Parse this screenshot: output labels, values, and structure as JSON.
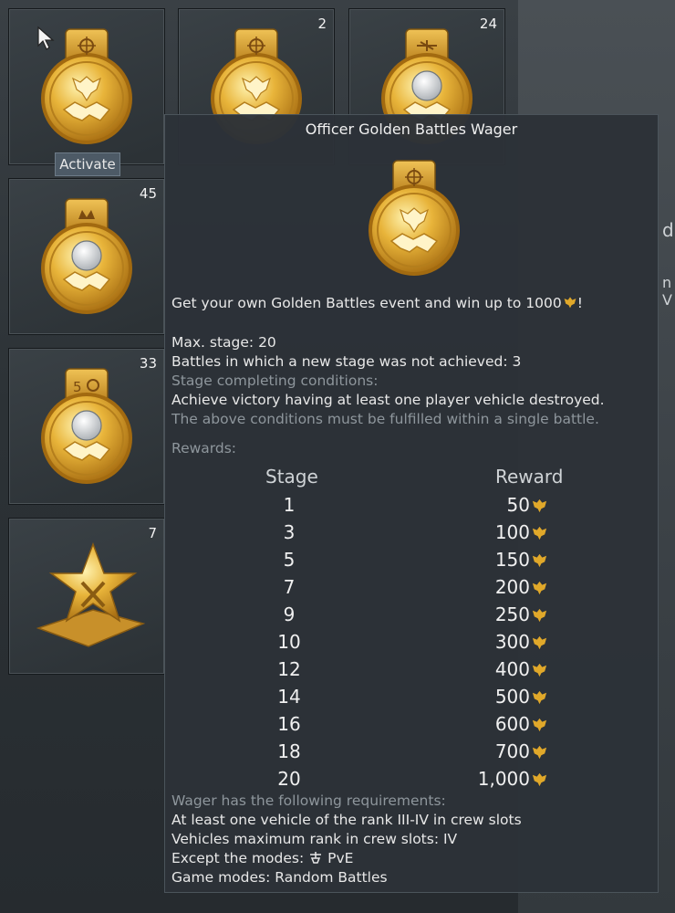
{
  "inventory": {
    "slots": [
      {
        "count": "",
        "icon": "golden-battles-wager-medal-eagle-crosshair-icon",
        "action": "Activate"
      },
      {
        "count": "2",
        "icon": "golden-battles-wager-medal-eagle-crosshair-icon"
      },
      {
        "count": "24",
        "icon": "golden-battles-wager-medal-lion-plane-icon"
      },
      {
        "count": "45",
        "icon": "golden-battles-wager-medal-lion-crown-icon"
      },
      {
        "count": "33",
        "icon": "golden-battles-wager-medal-lion-5-crosshair-icon"
      },
      {
        "count": "7",
        "icon": "gold-star-trophy-icon"
      }
    ]
  },
  "tooltip": {
    "title": "Officer Golden Battles Wager",
    "medal_icon": "golden-battles-wager-medal-eagle-crosshair-icon",
    "description": "Get your own Golden Battles event and win up to 1000",
    "description_end": "!",
    "max_stage": "Max. stage: 20",
    "battles_not_achieved": "Battles in which a new stage was not achieved: 3",
    "conditions_label": "Stage completing conditions:",
    "condition": "Achieve victory having at least one player vehicle destroyed.",
    "single_battle_note": "The above conditions must be fulfilled within a single battle.",
    "rewards_label": "Rewards:",
    "table_headers": {
      "stage": "Stage",
      "reward": "Reward"
    },
    "rewards": [
      {
        "stage": "1",
        "reward": "50"
      },
      {
        "stage": "3",
        "reward": "100"
      },
      {
        "stage": "5",
        "reward": "150"
      },
      {
        "stage": "7",
        "reward": "200"
      },
      {
        "stage": "9",
        "reward": "250"
      },
      {
        "stage": "10",
        "reward": "300"
      },
      {
        "stage": "12",
        "reward": "400"
      },
      {
        "stage": "14",
        "reward": "500"
      },
      {
        "stage": "16",
        "reward": "600"
      },
      {
        "stage": "18",
        "reward": "700"
      },
      {
        "stage": "20",
        "reward": "1,000"
      }
    ],
    "requirements_label": "Wager has the following requirements:",
    "req_rank": "At least one vehicle of the rank III-IV in crew slots",
    "req_max_rank": "Vehicles maximum rank in crew slots: IV",
    "req_except_prefix": "Except the modes: ",
    "req_except_mode": "PvE",
    "req_game_modes_prefix": "Game modes: ",
    "req_game_modes": "Random Battles"
  },
  "background_fragments": [
    "d",
    "n V"
  ],
  "colors": {
    "gold": "#e0a82a",
    "tooltip_bg": "#2c3238",
    "grey_text": "#8e969c"
  }
}
